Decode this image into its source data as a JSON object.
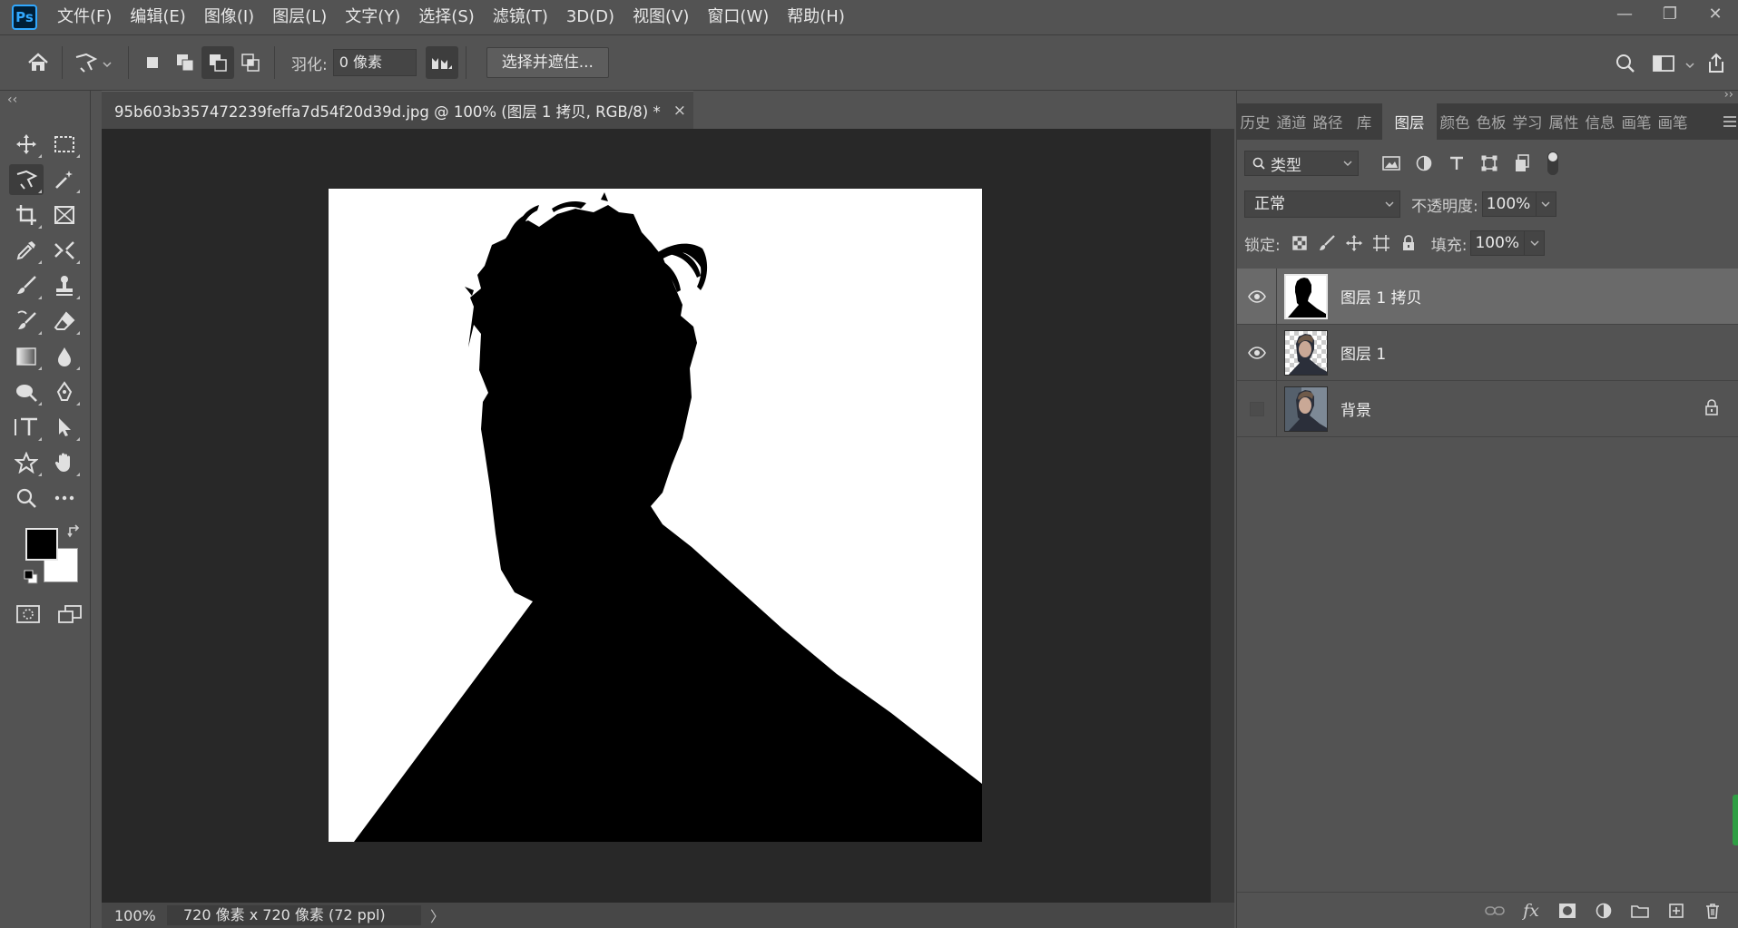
{
  "app": {
    "logo_text": "Ps"
  },
  "menu": [
    "文件(F)",
    "编辑(E)",
    "图像(I)",
    "图层(L)",
    "文字(Y)",
    "选择(S)",
    "滤镜(T)",
    "3D(D)",
    "视图(V)",
    "窗口(W)",
    "帮助(H)"
  ],
  "window_controls": {
    "minimize": "—",
    "restore": "❐",
    "close": "✕"
  },
  "options": {
    "feather_label": "羽化:",
    "feather_value": "0 像素",
    "select_mask_label": "选择并遮住..."
  },
  "document": {
    "tab_title": "95b603b357472239feffa7d54f20d39d.jpg @ 100% (图层 1 拷贝, RGB/8) *",
    "close_icon": "×",
    "zoom": "100%",
    "info": "720 像素 x 720 像素 (72 ppl)",
    "info_arrow": "〉"
  },
  "panel": {
    "tabs": [
      "历史",
      "通道",
      "路径",
      "库",
      "图层",
      "颜色",
      "色板",
      "学习",
      "属性",
      "信息",
      "画笔",
      "画笔"
    ],
    "active_tab": "图层",
    "filter_label": "类型",
    "blend_mode": "正常",
    "opacity_label": "不透明度:",
    "opacity_value": "100%",
    "lock_label": "锁定:",
    "fill_label": "填充:",
    "fill_value": "100%",
    "layers": [
      {
        "name": "图层 1 拷贝",
        "visible": true,
        "selected": true,
        "locked": false
      },
      {
        "name": "图层 1",
        "visible": true,
        "selected": false,
        "locked": false
      },
      {
        "name": "背景",
        "visible": false,
        "selected": false,
        "locked": true
      }
    ]
  },
  "colors": {
    "foreground": "#000000",
    "background": "#ffffff",
    "ps_blue": "#31a8ff"
  }
}
